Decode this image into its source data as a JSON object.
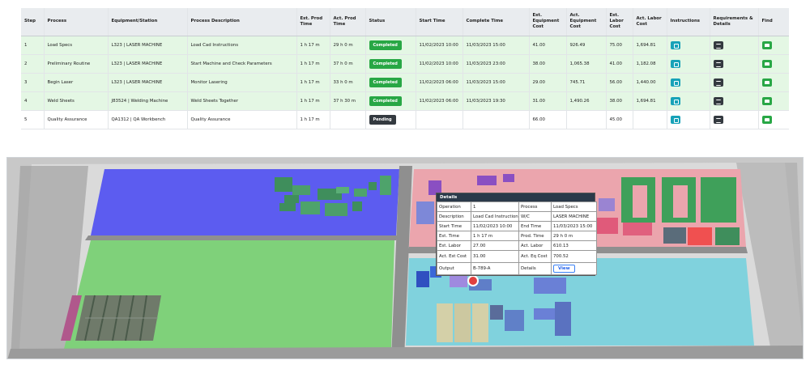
{
  "table": {
    "headers": [
      "Step",
      "Process",
      "Equipment/Station",
      "Process Description",
      "Est. Prod Time",
      "Act. Prod Time",
      "Status",
      "Start Time",
      "Complete Time",
      "Est. Equipment Cost",
      "Act. Equipment Cost",
      "Est. Labor Cost",
      "Act. Labor Cost",
      "Instructions",
      "Requirements & Details",
      "Find"
    ],
    "rows": [
      {
        "step": "1",
        "process": "Load Specs",
        "equipment": "L323 | LASER MACHINE",
        "description": "Load Cad Instructions",
        "est_prod_time": "1 h 17 m",
        "act_prod_time": "29 h 0 m",
        "status": "Completed",
        "start_time": "11/02/2023 10:00",
        "complete_time": "11/03/2023 15:00",
        "est_equipment_cost": "41.00",
        "act_equipment_cost": "926.49",
        "est_labor_cost": "75.00",
        "act_labor_cost": "1,694.81"
      },
      {
        "step": "2",
        "process": "Preliminary Routine",
        "equipment": "L323 | LASER MACHINE",
        "description": "Start Machine and Check Parameters",
        "est_prod_time": "1 h 17 m",
        "act_prod_time": "37 h 0 m",
        "status": "Completed",
        "start_time": "11/02/2023 10:00",
        "complete_time": "11/03/2023 23:00",
        "est_equipment_cost": "38.00",
        "act_equipment_cost": "1,065.38",
        "est_labor_cost": "41.00",
        "act_labor_cost": "1,182.08"
      },
      {
        "step": "3",
        "process": "Begin Laser",
        "equipment": "L323 | LASER MACHINE",
        "description": "Monitor Lasering",
        "est_prod_time": "1 h 17 m",
        "act_prod_time": "33 h 0 m",
        "status": "Completed",
        "start_time": "11/02/2023 06:00",
        "complete_time": "11/03/2023 15:00",
        "est_equipment_cost": "29.00",
        "act_equipment_cost": "745.71",
        "est_labor_cost": "56.00",
        "act_labor_cost": "1,440.00"
      },
      {
        "step": "4",
        "process": "Weld Sheets",
        "equipment": "J83524 | Welding Machine",
        "description": "Weld Sheets Together",
        "est_prod_time": "1 h 17 m",
        "act_prod_time": "37 h 30 m",
        "status": "Completed",
        "start_time": "11/02/2023 06:00",
        "complete_time": "11/03/2023 19:30",
        "est_equipment_cost": "31.00",
        "act_equipment_cost": "1,490.26",
        "est_labor_cost": "38.00",
        "act_labor_cost": "1,694.81"
      },
      {
        "step": "5",
        "process": "Quality Assurance",
        "equipment": "QA1312 | QA Workbench",
        "description": "Quality Assurance",
        "est_prod_time": "1 h 17 m",
        "act_prod_time": "",
        "status": "Pending",
        "start_time": "",
        "complete_time": "",
        "est_equipment_cost": "66.00",
        "act_equipment_cost": "",
        "est_labor_cost": "45.00",
        "act_labor_cost": ""
      }
    ],
    "icons": {
      "instructions": "document-icon",
      "requirements": "list-icon",
      "find": "thumbs-up-icon"
    }
  },
  "details": {
    "title": "Details",
    "rows": [
      [
        "Operation",
        "1",
        "Process",
        "Load Specs"
      ],
      [
        "Description",
        "Load Cad Instructions",
        "W/C",
        "LASER MACHINE"
      ],
      [
        "Start Time",
        "11/02/2023 10:00",
        "End Time",
        "11/03/2023 15:00"
      ],
      [
        "Est. Time",
        "1 h 17 m",
        "Prod. Time",
        "29 h 0 m"
      ],
      [
        "Est. Labor",
        "27.00",
        "Act. Labor",
        "610.13"
      ],
      [
        "Act. Est Cost",
        "31.00",
        "Act. Eq Cost",
        "700.52"
      ]
    ],
    "output_label": "Output",
    "output_value": "B-789-A",
    "details_label": "Details",
    "view_label": "View"
  },
  "colors": {
    "completed": "#28a745",
    "pending": "#343a40",
    "info": "#17a2b8",
    "zone_blue": "#5a5ae8",
    "zone_green": "#7fcf7a",
    "zone_pink": "#e8a0a8",
    "zone_cyan": "#7fd0dc"
  }
}
